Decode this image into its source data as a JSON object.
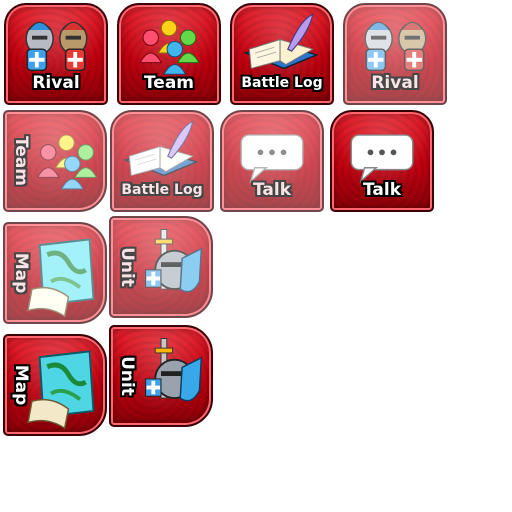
{
  "buttons": [
    {
      "id": "rival",
      "label": "Rival",
      "state": "active",
      "icon": "knights-icon"
    },
    {
      "id": "team",
      "label": "Team",
      "state": "active",
      "icon": "team-figures-icon"
    },
    {
      "id": "battle-log",
      "label": "Battle Log",
      "state": "active",
      "icon": "book-quill-icon"
    },
    {
      "id": "rival-dim",
      "label": "Rival",
      "state": "inactive",
      "icon": "knights-icon"
    },
    {
      "id": "team-vertical",
      "label": "Team",
      "state": "inactive",
      "icon": "team-figures-icon"
    },
    {
      "id": "battle-log-dim",
      "label": "Battle Log",
      "state": "inactive",
      "icon": "book-quill-icon"
    },
    {
      "id": "talk-dim",
      "label": "Talk",
      "state": "inactive",
      "icon": "speech-bubble-icon"
    },
    {
      "id": "talk",
      "label": "Talk",
      "state": "active",
      "icon": "speech-bubble-icon"
    },
    {
      "id": "map-dim",
      "label": "Map",
      "state": "inactive",
      "icon": "map-scroll-icon"
    },
    {
      "id": "unit-dim",
      "label": "Unit",
      "state": "inactive",
      "icon": "knight-shield-icon"
    },
    {
      "id": "map",
      "label": "Map",
      "state": "active",
      "icon": "map-scroll-icon"
    },
    {
      "id": "unit",
      "label": "Unit",
      "state": "active",
      "icon": "knight-shield-icon"
    }
  ],
  "colors": {
    "frame": "#c1000f",
    "frame_dark": "#3a0006",
    "label": "#ffffff"
  }
}
